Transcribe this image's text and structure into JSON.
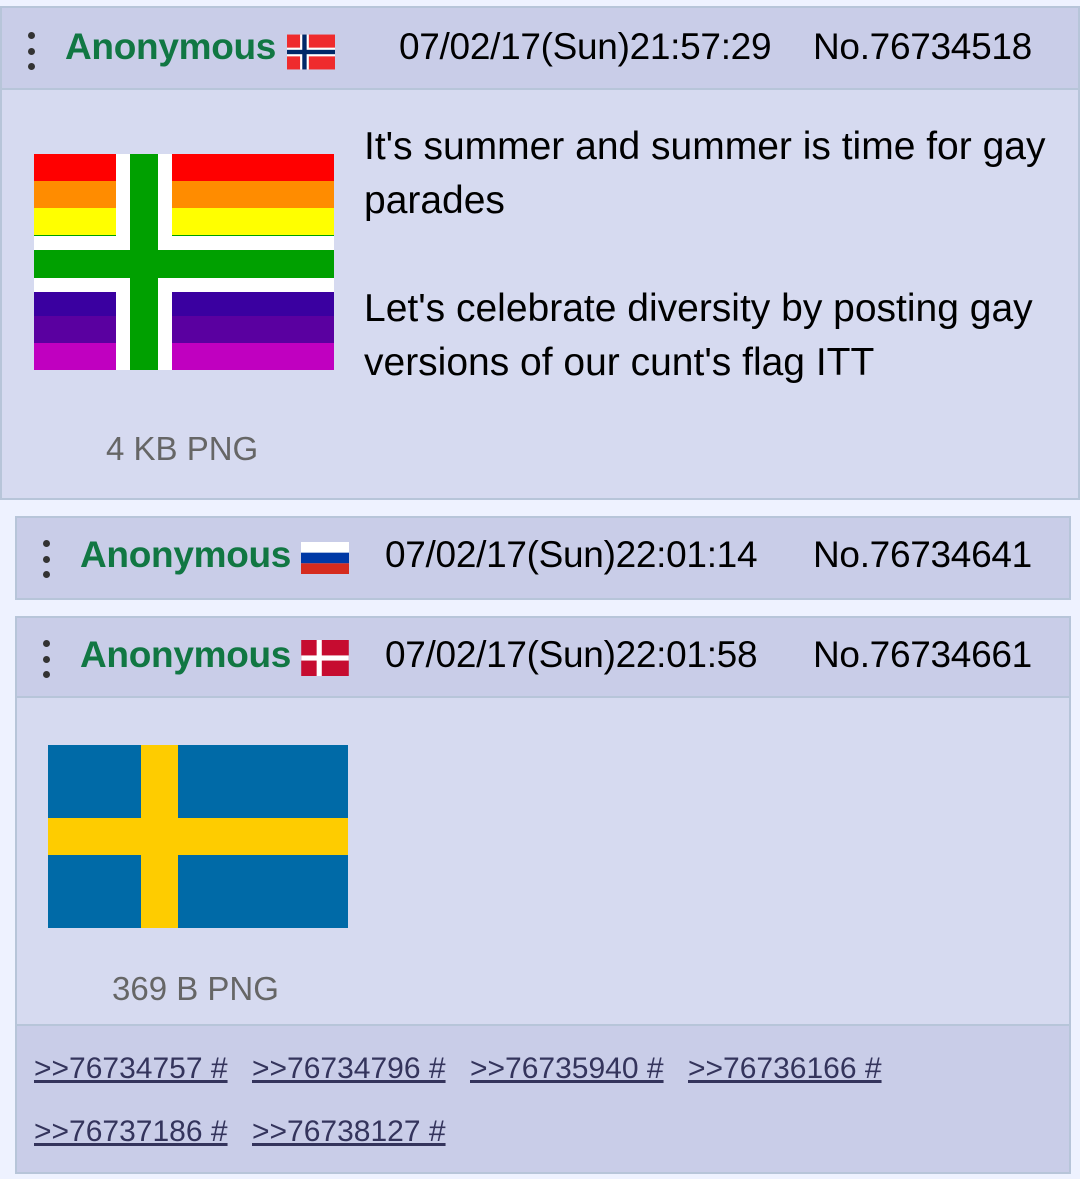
{
  "posts": [
    {
      "name": "Anonymous",
      "flag_icon": "norway-flag-icon",
      "datetime": "07/02/17(Sun)21:57:29",
      "post_no": "No.76734518",
      "image_icon": "gay-pride-cross-flag-image",
      "file_info": "4 KB PNG",
      "comment": [
        "It's summer and summer is time for gay parades",
        "Let's celebrate diversity by posting gay versions of our cunt's flag ITT"
      ]
    },
    {
      "name": "Anonymous",
      "flag_icon": "russia-flag-icon",
      "datetime": "07/02/17(Sun)22:01:14",
      "post_no": "No.76734641"
    },
    {
      "name": "Anonymous",
      "flag_icon": "denmark-flag-icon",
      "datetime": "07/02/17(Sun)22:01:58",
      "post_no": "No.76734661",
      "image_icon": "sweden-flag-image",
      "file_info": "369 B PNG",
      "replies": [
        ">>76734757 #",
        ">>76734796 #",
        ">>76735940 #",
        ">>76736166 #",
        ">>76737186 #",
        ">>76738127 #"
      ]
    }
  ],
  "colors": {
    "background": "#eef2ff",
    "post_bg": "#d6daf0",
    "header_bg": "#c9cde8",
    "border": "#b7c5d9",
    "name": "#117743",
    "link": "#34345c",
    "muted": "#666666"
  }
}
